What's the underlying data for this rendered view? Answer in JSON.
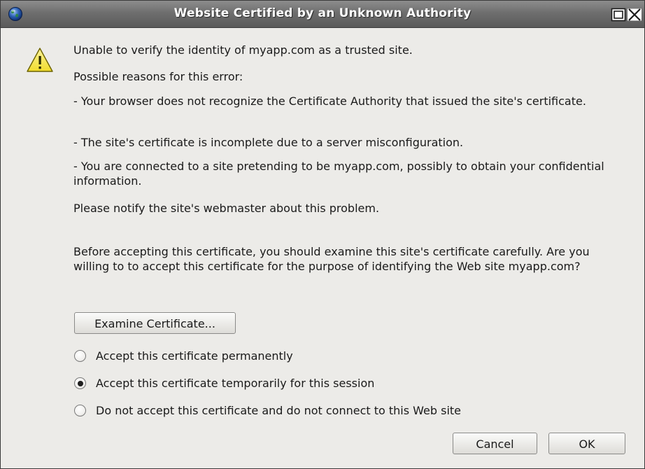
{
  "window": {
    "title": "Website Certified by an Unknown Authority"
  },
  "icons": {
    "app_icon": "globe-icon",
    "warning_icon": "warning-triangle-icon",
    "maximize_icon": "maximize-icon",
    "close_icon": "close-icon"
  },
  "message": {
    "headline": "Unable to verify the identity of myapp.com as a trusted site.",
    "reasons_intro": "Possible reasons for this error:",
    "reasons": [
      "- Your browser does not recognize the Certificate Authority that issued the site's certificate.",
      "- The site's certificate is incomplete due to a server misconfiguration.",
      "- You are connected to a site pretending to be myapp.com, possibly to obtain your confidential information."
    ],
    "notify": "Please notify the site's webmaster about this problem.",
    "question": "Before accepting this certificate, you should examine this site's certificate carefully. Are you willing to to accept this certificate for the purpose of identifying the Web site myapp.com?"
  },
  "examine_button": "Examine Certificate...",
  "options": [
    {
      "label": "Accept this certificate permanently",
      "selected": false
    },
    {
      "label": "Accept this certificate temporarily for this session",
      "selected": true
    },
    {
      "label": "Do not accept this certificate and do not connect to this Web site",
      "selected": false
    }
  ],
  "buttons": {
    "cancel": "Cancel",
    "ok": "OK"
  },
  "colors": {
    "titlebar": "#6e6e6e",
    "dialog_bg": "#ecebe8",
    "warning_yellow": "#f5e33a"
  }
}
